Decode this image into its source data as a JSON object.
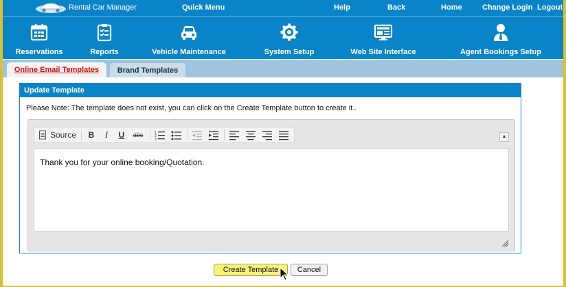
{
  "topbar": {
    "app_name": "Rental Car Manager",
    "quick_menu": "Quick Menu",
    "help": "Help",
    "back": "Back",
    "home": "Home",
    "change_login": "Change Login",
    "logout": "Logout"
  },
  "nav": [
    {
      "label": "Reservations",
      "icon": "calendar-icon"
    },
    {
      "label": "Reports",
      "icon": "checklist-icon"
    },
    {
      "label": "Vehicle Maintenance",
      "icon": "car-icon"
    },
    {
      "label": "System Setup",
      "icon": "gear-icon"
    },
    {
      "label": "Web Site Interface",
      "icon": "monitor-icon"
    },
    {
      "label": "Agent Bookings Setup",
      "icon": "agent-icon"
    }
  ],
  "tabs": {
    "email": "Online Email Templates",
    "brand": "Brand Templates"
  },
  "panel": {
    "title": "Update Template",
    "note": "Please Note: The template does not exist, you can click on the Create Template button to create it.."
  },
  "editor": {
    "source_label": "Source",
    "bold": "B",
    "italic": "I",
    "underline": "U",
    "strike": "abc",
    "content": "Thank you for your online booking/Quotation."
  },
  "buttons": {
    "create": "Create Template",
    "cancel": "Cancel"
  },
  "colors": {
    "primary": "#0a84c8",
    "border_outer": "#d8c230",
    "create_button": "#f7f27a"
  }
}
